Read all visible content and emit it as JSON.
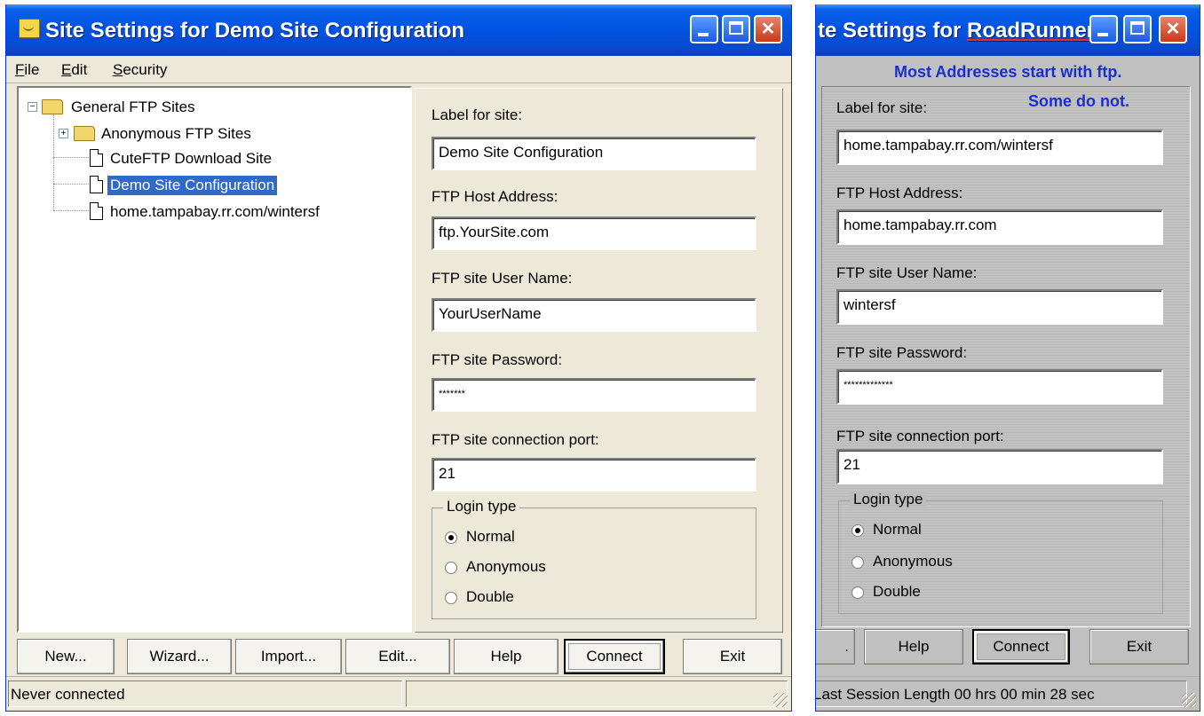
{
  "w1": {
    "title": "Site Settings for Demo Site Configuration",
    "menu": [
      "File",
      "Edit",
      "Security"
    ],
    "tree": {
      "root": "General FTP Sites",
      "items": [
        "Anonymous FTP Sites",
        "CuteFTP Download Site",
        "Demo Site Configuration",
        "home.tampabay.rr.com/wintersf"
      ]
    },
    "form": {
      "label_site": "Label for site:",
      "label_site_value": "Demo Site Configuration",
      "host_label": "FTP Host Address:",
      "host_value": "ftp.YourSite.com",
      "user_label": "FTP site User Name:",
      "user_value": "YourUserName",
      "pass_label": "FTP site Password:",
      "pass_value": "*******",
      "port_label": "FTP site connection port:",
      "port_value": "21",
      "login_type": "Login type",
      "options": [
        "Normal",
        "Anonymous",
        "Double"
      ],
      "selected": "Normal"
    },
    "buttons": {
      "new": "New...",
      "wizard": "Wizard...",
      "import": "Import...",
      "edit": "Edit...",
      "help": "Help",
      "connect": "Connect",
      "exit": "Exit"
    },
    "status": "Never connected"
  },
  "w2": {
    "title_prefix": "te Settings for ",
    "title_name": "RoadRunner",
    "note1": "Most Addresses start with ftp.",
    "note2": "Some do not.",
    "form": {
      "label_site": "Label for site:",
      "label_site_value": "home.tampabay.rr.com/wintersf",
      "host_label": "FTP Host Address:",
      "host_value": "home.tampabay.rr.com",
      "user_label": "FTP site User Name:",
      "user_value": "wintersf",
      "pass_label": "FTP site Password:",
      "pass_value": "*************",
      "port_label": "FTP site connection port:",
      "port_value": "21",
      "login_type": "Login type",
      "options": [
        "Normal",
        "Anonymous",
        "Double"
      ],
      "selected": "Normal"
    },
    "buttons": {
      "partial": ".",
      "help": "Help",
      "connect": "Connect",
      "exit": "Exit"
    },
    "status": "Last Session Length 00 hrs 00 min 28 sec"
  },
  "colors": {
    "titlebar": "#0054e3",
    "selection": "#316ac5",
    "note": "#1a2fd0"
  }
}
